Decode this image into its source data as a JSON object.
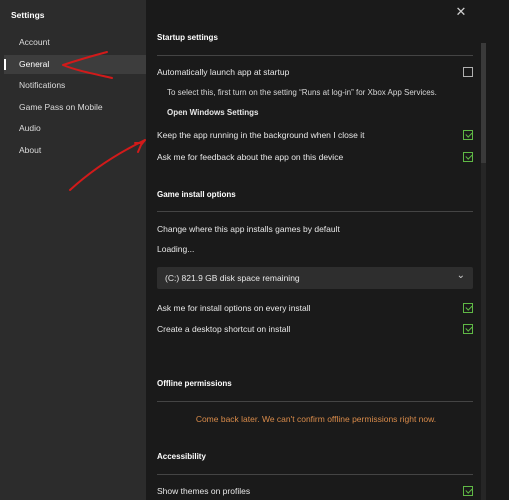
{
  "sidebar": {
    "title": "Settings",
    "items": [
      {
        "label": "Account"
      },
      {
        "label": "General"
      },
      {
        "label": "Notifications"
      },
      {
        "label": "Game Pass on Mobile"
      },
      {
        "label": "Audio"
      },
      {
        "label": "About"
      }
    ],
    "active_index": 1
  },
  "window": {
    "close_glyph": "✕"
  },
  "startup": {
    "title": "Startup settings",
    "auto_launch_label": "Automatically launch app at startup",
    "auto_launch_checked": false,
    "note": "To select this, first turn on the setting “Runs at log-in” for Xbox App Services.",
    "open_windows_settings_label": "Open Windows Settings",
    "keep_running_label": "Keep the app running in the background when I close it",
    "keep_running_checked": true,
    "feedback_label": "Ask me for feedback about the app on this device",
    "feedback_checked": true
  },
  "install": {
    "title": "Game install options",
    "change_location_label": "Change where this app installs games by default",
    "loading_label": "Loading...",
    "drive_value": "(C:) 821.9 GB disk space remaining",
    "ask_options_label": "Ask me for install options on every install",
    "ask_options_checked": true,
    "desktop_shortcut_label": "Create a desktop shortcut on install",
    "desktop_shortcut_checked": true
  },
  "offline": {
    "title": "Offline permissions",
    "message": "Come back later. We can't confirm offline permissions right now."
  },
  "accessibility": {
    "title": "Accessibility",
    "themes_label": "Show themes on profiles",
    "themes_checked": true
  },
  "colors": {
    "accent_check": "#5fb845",
    "warning_text": "#d98b4a",
    "annotation_red": "#d21a1a"
  }
}
